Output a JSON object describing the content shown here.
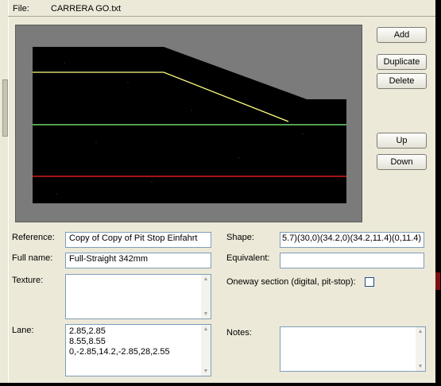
{
  "file": {
    "label": "File:",
    "name": "CARRERA GO.txt"
  },
  "buttons": {
    "add": "Add",
    "duplicate": "Duplicate",
    "delete": "Delete",
    "up": "Up",
    "down": "Down"
  },
  "form": {
    "reference": {
      "label": "Reference:",
      "value": "Copy of Copy of Pit Stop Einfahrt"
    },
    "full_name": {
      "label": "Full name:",
      "value": "Full-Straight 342mm"
    },
    "texture": {
      "label": "Texture:",
      "value": ""
    },
    "lane": {
      "label": "Lane:",
      "lines": [
        "2.85,2.85",
        "8.55,8.55",
        "0,-2.85,14.2,-2.85,28,2.55"
      ]
    },
    "shape": {
      "label": "Shape:",
      "value": "5.7)(30,0)(34.2,0)(34.2,11.4)(0,11.4)"
    },
    "equivalent": {
      "label": "Equivalent:",
      "value": ""
    },
    "oneway": {
      "label": "Oneway section (digital, pit-stop):",
      "checked": false
    },
    "notes": {
      "label": "Notes:",
      "value": ""
    }
  },
  "colors": {
    "window": "#ece9d8",
    "preview_frame": "#7b7b7b",
    "track": "#000000",
    "lane_yellow": "#ffff80",
    "lane_green": "#80ff80",
    "lane_red": "#ff2020"
  }
}
